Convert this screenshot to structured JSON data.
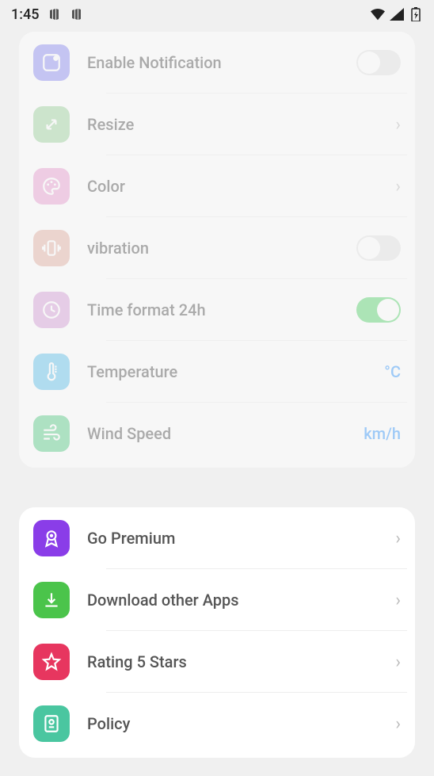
{
  "status": {
    "time": "1:45"
  },
  "section1": {
    "items": [
      {
        "label": "Enable Notification",
        "kind": "toggle",
        "state": "off",
        "iconColor": "#8e8ef4",
        "iconName": "notification-icon"
      },
      {
        "label": "Resize",
        "kind": "nav",
        "iconColor": "#9fd49f",
        "iconName": "resize-icon"
      },
      {
        "label": "Color",
        "kind": "nav",
        "iconColor": "#eaa1d2",
        "iconName": "palette-icon"
      },
      {
        "label": "vibration",
        "kind": "toggle",
        "state": "off",
        "iconColor": "#e4b1a5",
        "iconName": "vibration-icon"
      },
      {
        "label": "Time format 24h",
        "kind": "toggle",
        "state": "on",
        "iconColor": "#d79fd9",
        "iconName": "clock-icon"
      },
      {
        "label": "Temperature",
        "kind": "value",
        "value": "°C",
        "iconColor": "#63c3ee",
        "iconName": "thermometer-icon"
      },
      {
        "label": "Wind Speed",
        "kind": "value",
        "value": "km/h",
        "iconColor": "#5cce8a",
        "iconName": "wind-icon"
      }
    ]
  },
  "section2": {
    "items": [
      {
        "label": "Go Premium",
        "kind": "nav",
        "iconColor": "#8a3de8",
        "iconName": "premium-icon"
      },
      {
        "label": "Download other Apps",
        "kind": "nav",
        "iconColor": "#4bc44b",
        "iconName": "download-icon"
      },
      {
        "label": "Rating 5 Stars",
        "kind": "nav",
        "iconColor": "#e7365f",
        "iconName": "star-icon"
      },
      {
        "label": "Policy",
        "kind": "nav",
        "iconColor": "#4ac6a0",
        "iconName": "policy-icon"
      }
    ]
  }
}
